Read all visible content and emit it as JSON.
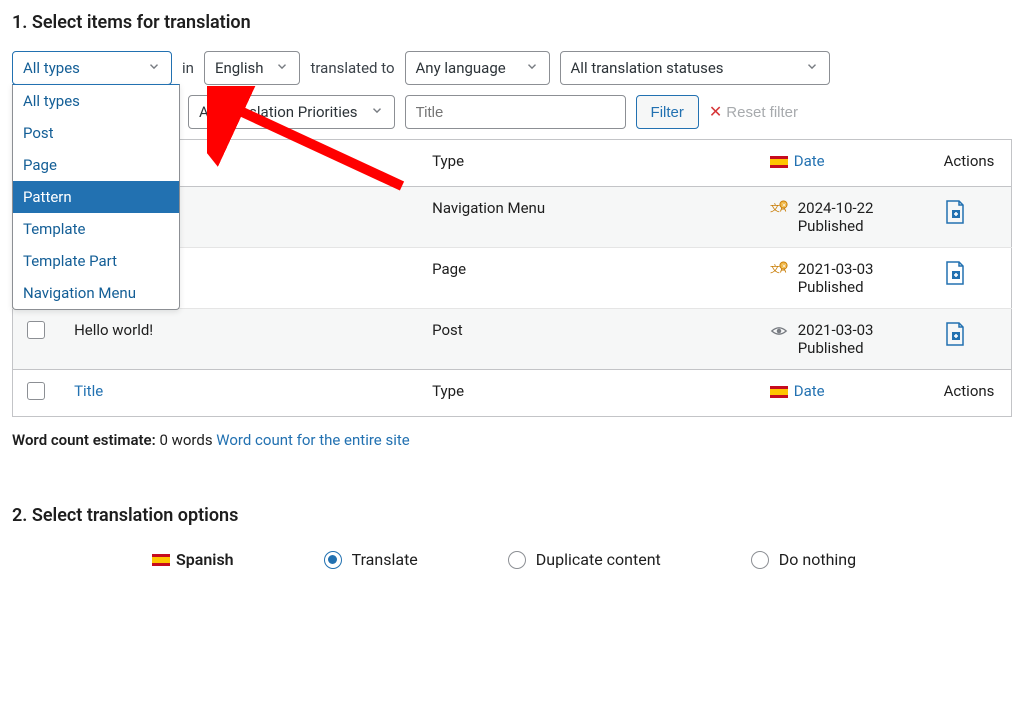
{
  "section1_title": "1. Select items for translation",
  "filters": {
    "type": {
      "label": "All types",
      "options": [
        "All types",
        "Post",
        "Page",
        "Pattern",
        "Template",
        "Template Part",
        "Navigation Menu"
      ],
      "selected": "Pattern"
    },
    "in_label": "in",
    "language": "English",
    "translated_to_label": "translated to",
    "any_language": "Any language",
    "status": "All translation statuses",
    "priority": "All Translation Priorities",
    "title_placeholder": "Title",
    "filter_btn": "Filter",
    "reset_btn": "Reset filter"
  },
  "table": {
    "headers": {
      "title": "Title",
      "type": "Type",
      "date": "Date",
      "actions": "Actions"
    },
    "rows": [
      {
        "title": "",
        "type": "Navigation Menu",
        "status_icon": "translate-needed",
        "date": "2024-10-22",
        "pub": "Published"
      },
      {
        "title": "",
        "type": "Page",
        "status_icon": "translate-needed",
        "date": "2021-03-03",
        "pub": "Published"
      },
      {
        "title": "Hello world!",
        "type": "Post",
        "status_icon": "eye",
        "date": "2021-03-03",
        "pub": "Published"
      }
    ]
  },
  "word_count": {
    "label": "Word count estimate:",
    "value": "0 words",
    "link": "Word count for the entire site"
  },
  "section2_title": "2. Select translation options",
  "options": {
    "language": "Spanish",
    "radios": [
      {
        "label": "Translate",
        "checked": true
      },
      {
        "label": "Duplicate content",
        "checked": false
      },
      {
        "label": "Do nothing",
        "checked": false
      }
    ]
  }
}
